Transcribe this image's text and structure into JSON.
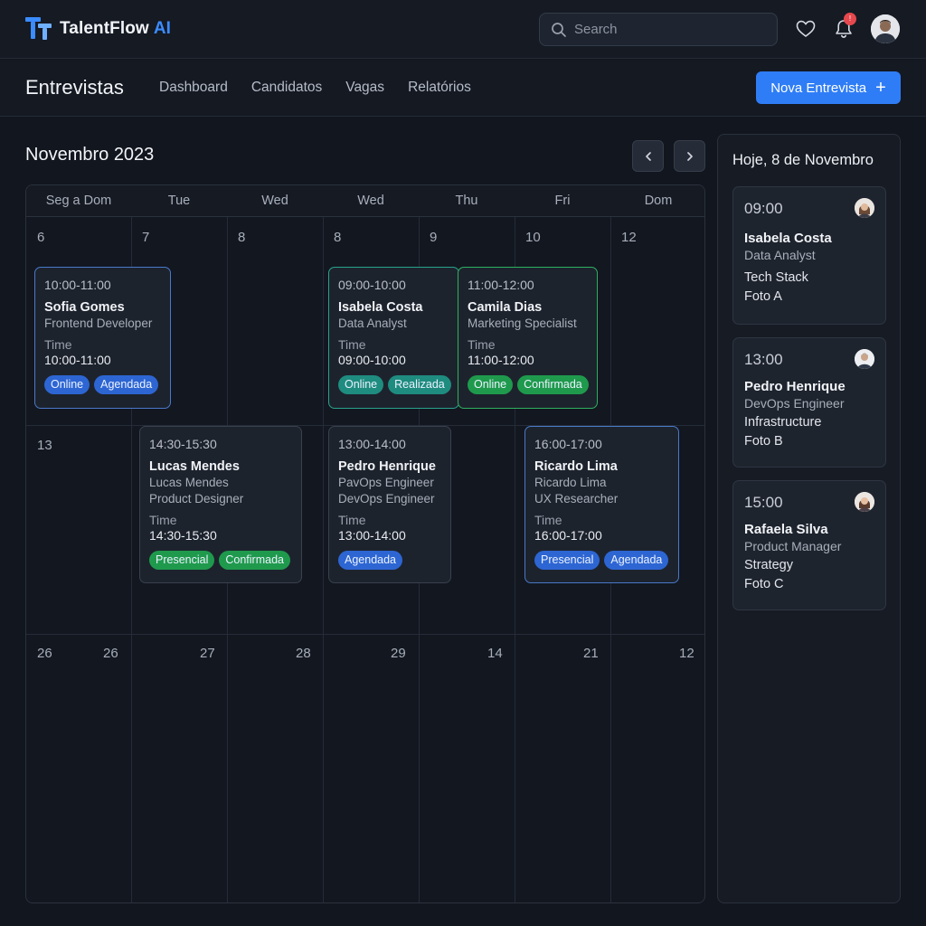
{
  "app": {
    "name": "TalentFlow",
    "name_suffix": "AI",
    "accent": "#2f7df6"
  },
  "search": {
    "placeholder": "Search"
  },
  "subnav": {
    "title": "Entrevistas",
    "links": [
      "Dashboard",
      "Candidatos",
      "Vagas",
      "Relatórios"
    ],
    "new_button": "Nova Entrevista"
  },
  "calendar": {
    "month": "Novembro 2023",
    "day_headers": [
      "Seg a Dom",
      "Tue",
      "Wed",
      "Wed",
      "Thu",
      "Fri",
      "Dom"
    ],
    "weeks": [
      [
        "6",
        "7",
        "8",
        "8",
        "9",
        "10",
        "12"
      ],
      [
        "13"
      ],
      [
        "26",
        "26",
        "27",
        "28",
        "29",
        "14",
        "21",
        "12"
      ]
    ],
    "events": [
      {
        "time": "10:00-11:00",
        "name": "Sofia Gomes",
        "roles": [
          "Frontend Developer"
        ],
        "label": "Time",
        "value": "10:00-11:00",
        "badges": [
          "Online",
          "Agendada"
        ]
      },
      {
        "time": "09:00-10:00",
        "name": "Isabela Costa",
        "roles": [
          "Data Analyst"
        ],
        "label": "Time",
        "value": "09:00-10:00",
        "badges": [
          "Online",
          "Realizada"
        ]
      },
      {
        "time": "11:00-12:00",
        "name": "Camila Dias",
        "roles": [
          "Marketing Specialist"
        ],
        "label": "Time",
        "value": "11:00-12:00",
        "badges": [
          "Online",
          "Confirmada"
        ]
      },
      {
        "time": "14:30-15:30",
        "name": "Lucas Mendes",
        "roles": [
          "Lucas Mendes",
          "Product Designer"
        ],
        "label": "Time",
        "value": "14:30-15:30",
        "badges": [
          "Presencial",
          "Confirmada"
        ]
      },
      {
        "time": "13:00-14:00",
        "name": "Pedro Henrique",
        "roles": [
          "PavOps Engineer",
          "DevOps Engineer"
        ],
        "label": "Time",
        "value": "13:00-14:00",
        "badges": [
          "Agendada"
        ]
      },
      {
        "time": "16:00-17:00",
        "name": "Ricardo Lima",
        "roles": [
          "Ricardo Lima",
          "UX Researcher"
        ],
        "label": "Time",
        "value": "16:00-17:00",
        "badges": [
          "Presencial",
          "Agendada"
        ]
      }
    ]
  },
  "today": {
    "title": "Hoje, 8 de Novembro",
    "items": [
      {
        "time": "09:00",
        "name": "Isabela Costa",
        "role": "Data Analyst",
        "detail": "Tech Stack",
        "photo": "Foto A"
      },
      {
        "time": "13:00",
        "name": "Pedro Henrique",
        "role": "DevOps Engineer",
        "detail": "Infrastructure",
        "photo": "Foto B"
      },
      {
        "time": "15:00",
        "name": "Rafaela Silva",
        "role": "Product Manager",
        "detail": "Strategy",
        "photo": "Foto C"
      }
    ]
  }
}
